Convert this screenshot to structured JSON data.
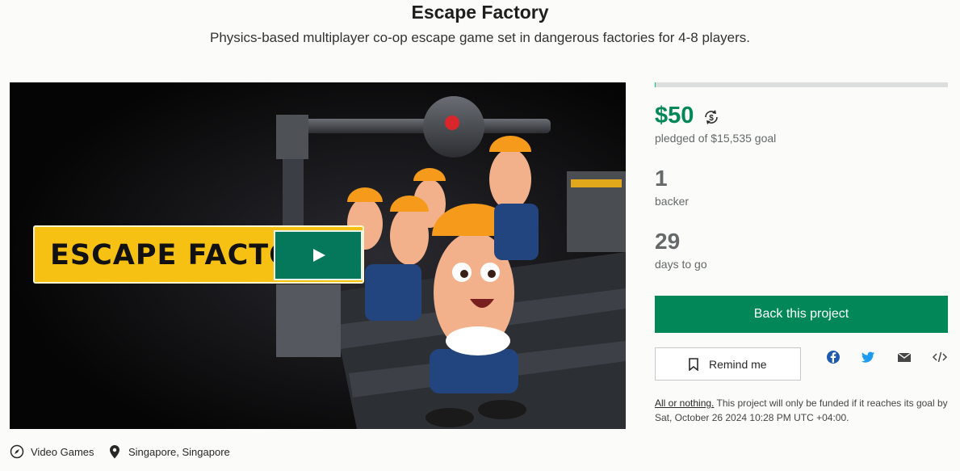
{
  "project": {
    "title": "Escape Factory",
    "subtitle": "Physics-based multiplayer co-op escape game set in dangerous factories for 4-8 players."
  },
  "video": {
    "banner_text": "ESCAPE FACTORY",
    "play_icon": "play-icon"
  },
  "funding": {
    "pledged": "$50",
    "pledged_label": "pledged of $15,535 goal",
    "progress_fraction": 0.0032,
    "currency_icon": "currency-conversion-icon",
    "backers": "1",
    "backers_label": "backer",
    "days": "29",
    "days_label": "days to go"
  },
  "actions": {
    "back_label": "Back this project",
    "remind_label": "Remind me",
    "share_icons": [
      "facebook-icon",
      "twitter-icon",
      "email-icon",
      "embed-icon"
    ]
  },
  "terms": {
    "emphasis": "All or nothing.",
    "text": " This project will only be funded if it reaches its goal by Sat, October 26 2024 10:28 PM UTC +04:00."
  },
  "meta": {
    "category": "Video Games",
    "location": "Singapore, Singapore"
  },
  "colors": {
    "accent": "#028858",
    "progress": "#05ce78",
    "banner": "#f6c112"
  }
}
